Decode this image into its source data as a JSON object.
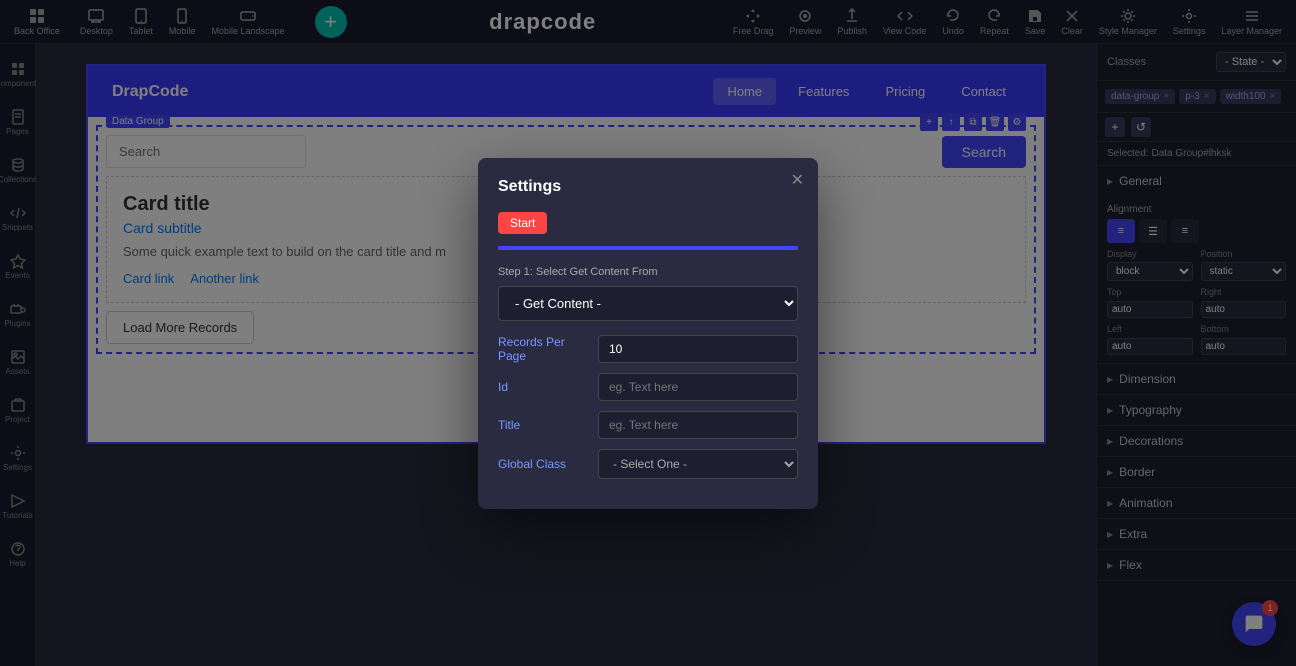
{
  "toolbar": {
    "back_office": "Back Office",
    "desktop": "Desktop",
    "tablet": "Tablet",
    "mobile": "Mobile",
    "mobile_landscape": "Mobile Landscape",
    "free_drag": "Free Drag",
    "preview": "Preview",
    "publish": "Publish",
    "view_code": "View Code",
    "undo": "Undo",
    "repeat": "Repeat",
    "save": "Save",
    "clear": "Clear",
    "style_manager": "Style Manager",
    "settings": "Settings",
    "layer_manager": "Layer Manager",
    "logo": "drapcode"
  },
  "sidebar": {
    "components_label": "Components",
    "pages_label": "Pages",
    "collections_label": "Collections",
    "snippets_label": "Snippets",
    "events_label": "Events",
    "plugins_label": "Plugins",
    "assets_label": "Assets",
    "project_label": "Project",
    "settings_label": "Settings",
    "tutorials_label": "Tutorials",
    "help_label": "Help"
  },
  "preview": {
    "brand": "DrapCode",
    "nav_links": [
      "Home",
      "Features",
      "Pricing",
      "Contact"
    ],
    "active_nav": "Home",
    "data_group_label": "Data Group",
    "search_placeholder": "Search",
    "search_btn": "Search",
    "card_title": "Card title",
    "card_subtitle": "Card subtitle",
    "card_text": "Some quick example text to build on the card title and m",
    "card_link1": "Card link",
    "card_link2": "Another link",
    "load_more": "Load More Records"
  },
  "right_panel": {
    "classes_label": "Classes",
    "state_label": "- State -",
    "tags": [
      "data-group",
      "p-3",
      "width100"
    ],
    "selected_info": "Selected: Data Group#lhksk",
    "general_label": "General",
    "alignment_label": "Alignment",
    "align_options": [
      "left",
      "center",
      "right"
    ],
    "display_label": "Display",
    "display_value": "block",
    "position_label": "Position",
    "position_value": "static",
    "top_label": "Top",
    "top_value": "auto",
    "right_label": "Right",
    "right_value": "auto",
    "left_label": "Left",
    "left_value": "auto",
    "bottom_label": "Bottom",
    "bottom_value": "auto",
    "dimension_label": "Dimension",
    "typography_label": "Typography",
    "decorations_label": "Decorations",
    "border_label": "Border",
    "animation_label": "Animation",
    "extra_label": "Extra",
    "flex_label": "Flex"
  },
  "modal": {
    "title": "Settings",
    "start_btn": "Start",
    "step_label": "Step 1: Select Get Content From",
    "content_select_placeholder": "- Get Content -",
    "records_per_page_label": "Records Per Page",
    "records_per_page_value": "10",
    "id_label": "Id",
    "id_placeholder": "eg. Text here",
    "title_label": "Title",
    "title_placeholder": "eg. Text here",
    "global_class_label": "Global Class",
    "global_class_placeholder": "- Select One -"
  },
  "chat": {
    "badge_count": "1"
  }
}
